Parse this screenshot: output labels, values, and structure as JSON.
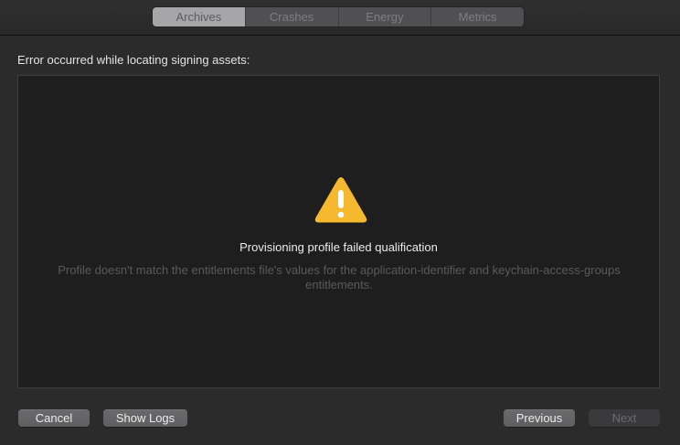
{
  "tabs": [
    {
      "label": "Archives",
      "active": true
    },
    {
      "label": "Crashes",
      "active": false
    },
    {
      "label": "Energy",
      "active": false
    },
    {
      "label": "Metrics",
      "active": false
    }
  ],
  "heading": "Error occurred while locating signing assets:",
  "error": {
    "icon": "warning-triangle-icon",
    "title": "Provisioning profile failed qualification",
    "description": "Profile doesn't match the entitlements file's values for the application-identifier and keychain-access-groups entitlements."
  },
  "buttons": {
    "cancel": "Cancel",
    "show_logs": "Show Logs",
    "previous": "Previous",
    "next": "Next"
  },
  "colors": {
    "warning": "#f5b82e",
    "background": "#2b2b2c",
    "panel": "#1e1e1f"
  }
}
